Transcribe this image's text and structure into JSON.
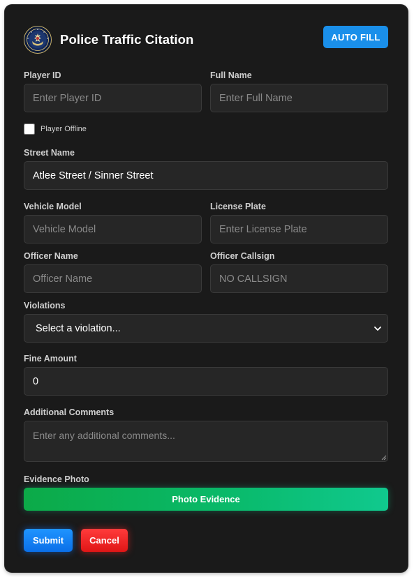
{
  "header": {
    "title": "Police Traffic Citation",
    "autofill_label": "AUTO FILL",
    "seal_icon": "presidential-seal-icon"
  },
  "form": {
    "player_id": {
      "label": "Player ID",
      "value": "",
      "placeholder": "Enter Player ID"
    },
    "full_name": {
      "label": "Full Name",
      "value": "",
      "placeholder": "Enter Full Name"
    },
    "player_offline": {
      "label": "Player Offline",
      "checked": false
    },
    "street_name": {
      "label": "Street Name",
      "value": "Atlee Street / Sinner Street",
      "placeholder": ""
    },
    "vehicle_model": {
      "label": "Vehicle Model",
      "value": "",
      "placeholder": "Vehicle Model"
    },
    "license_plate": {
      "label": "License Plate",
      "value": "",
      "placeholder": "Enter License Plate"
    },
    "officer_name": {
      "label": "Officer Name",
      "value": "",
      "placeholder": "Officer Name"
    },
    "officer_callsign": {
      "label": "Officer Callsign",
      "value": "",
      "placeholder": "NO CALLSIGN"
    },
    "violations": {
      "label": "Violations",
      "selected": "Select a violation..."
    },
    "fine_amount": {
      "label": "Fine Amount",
      "value": "0"
    },
    "comments": {
      "label": "Additional Comments",
      "value": "",
      "placeholder": "Enter any additional comments..."
    },
    "evidence": {
      "label": "Evidence Photo",
      "button_label": "Photo Evidence"
    }
  },
  "actions": {
    "submit_label": "Submit",
    "cancel_label": "Cancel"
  },
  "colors": {
    "panel_bg": "#1a1a1a",
    "input_bg": "#262626",
    "autofill": "#1a8fea",
    "submit": "#0a6fe8",
    "cancel": "#e01616",
    "evidence_gradient_start": "#0caa48",
    "evidence_gradient_end": "#10c98e"
  }
}
